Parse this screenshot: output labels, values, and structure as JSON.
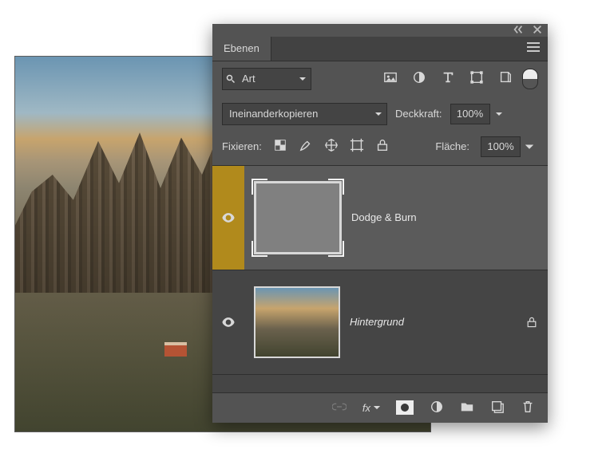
{
  "panel": {
    "tab_label": "Ebenen",
    "search": {
      "label": "Art"
    },
    "blend_mode": "Ineinanderkopieren",
    "opacity_label": "Deckkraft:",
    "opacity_value": "100%",
    "lock_label": "Fixieren:",
    "fill_label": "Fläche:",
    "fill_value": "100%"
  },
  "layers": [
    {
      "name": "Dodge & Burn",
      "selected": true,
      "visible": true,
      "locked": false
    },
    {
      "name": "Hintergrund",
      "selected": false,
      "visible": true,
      "locked": true
    }
  ],
  "bottombar": {
    "fx_label": "fx"
  }
}
